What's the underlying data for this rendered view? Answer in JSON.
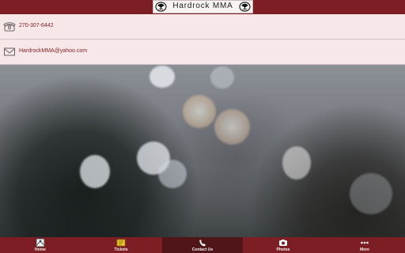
{
  "app": {
    "title": "Hardrock  MMA"
  },
  "contacts": [
    {
      "type": "phone",
      "icon": "phone-icon",
      "text": "270-307-6442"
    },
    {
      "type": "email",
      "icon": "email-icon",
      "text": "HardrockMMA@yahoo.com"
    }
  ],
  "tabs": [
    {
      "label": "Home",
      "icon": "home-icon",
      "active": false
    },
    {
      "label": "Tickets",
      "icon": "tickets-icon",
      "active": false
    },
    {
      "label": "Contact Us",
      "icon": "phone-handset-icon",
      "active": true
    },
    {
      "label": "Photos",
      "icon": "camera-icon",
      "active": false
    },
    {
      "label": "More",
      "icon": "more-dots-icon",
      "active": false
    }
  ],
  "colors": {
    "header": "#7d1e24",
    "row_background": "#f8e7e8",
    "tab_active": "#4f1519"
  }
}
